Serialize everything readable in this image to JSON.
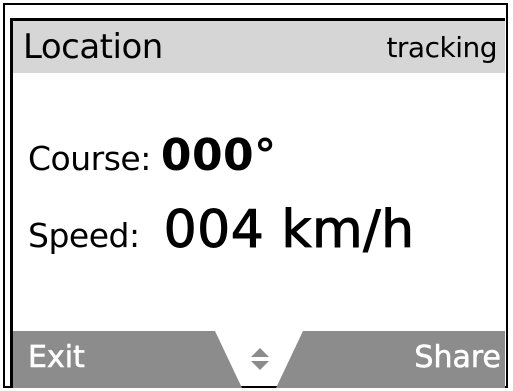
{
  "header": {
    "title": "Location",
    "status": "tracking"
  },
  "readings": {
    "course_label": "Course:",
    "course_value": "000°",
    "speed_label": "Speed:",
    "speed_value": "004 km/h"
  },
  "softkeys": {
    "left_label": "Exit",
    "right_label": "Share",
    "center_icon": "up-down-navigation-icon"
  },
  "colors": {
    "bar_gray": "#d6d6d6",
    "softkey_gray": "#8c8c8c",
    "text": "#000000",
    "softkey_text": "#ffffff"
  }
}
